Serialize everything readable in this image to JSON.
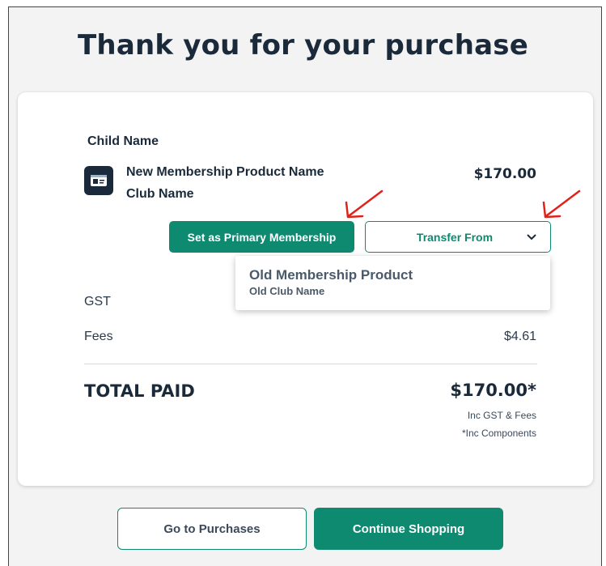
{
  "page": {
    "title": "Thank you for your purchase"
  },
  "order": {
    "child_name": "Child Name",
    "product_name": "New Membership Product Name",
    "club_name": "Club Name",
    "price": "$170.00"
  },
  "actions": {
    "primary_label": "Set as Primary Membership",
    "transfer_label": "Transfer From"
  },
  "dropdown": {
    "option_product": "Old Membership Product",
    "option_club": "Old Club Name"
  },
  "summary": {
    "gst_label": "GST",
    "fees_label": "Fees",
    "fees_value": "$4.61",
    "total_label": "TOTAL PAID",
    "total_value": "$170.00*",
    "note1": "Inc GST & Fees",
    "note2": "*Inc Components"
  },
  "footer": {
    "go_purchases": "Go to Purchases",
    "continue_shopping": "Continue Shopping"
  },
  "colors": {
    "brand": "#0e8a71",
    "navy": "#1b2a3a",
    "arrow": "#e0221b"
  },
  "icons": {
    "product": "id-card-icon",
    "chevron": "chevron-down-icon",
    "annotation": "red-arrow-icon"
  }
}
